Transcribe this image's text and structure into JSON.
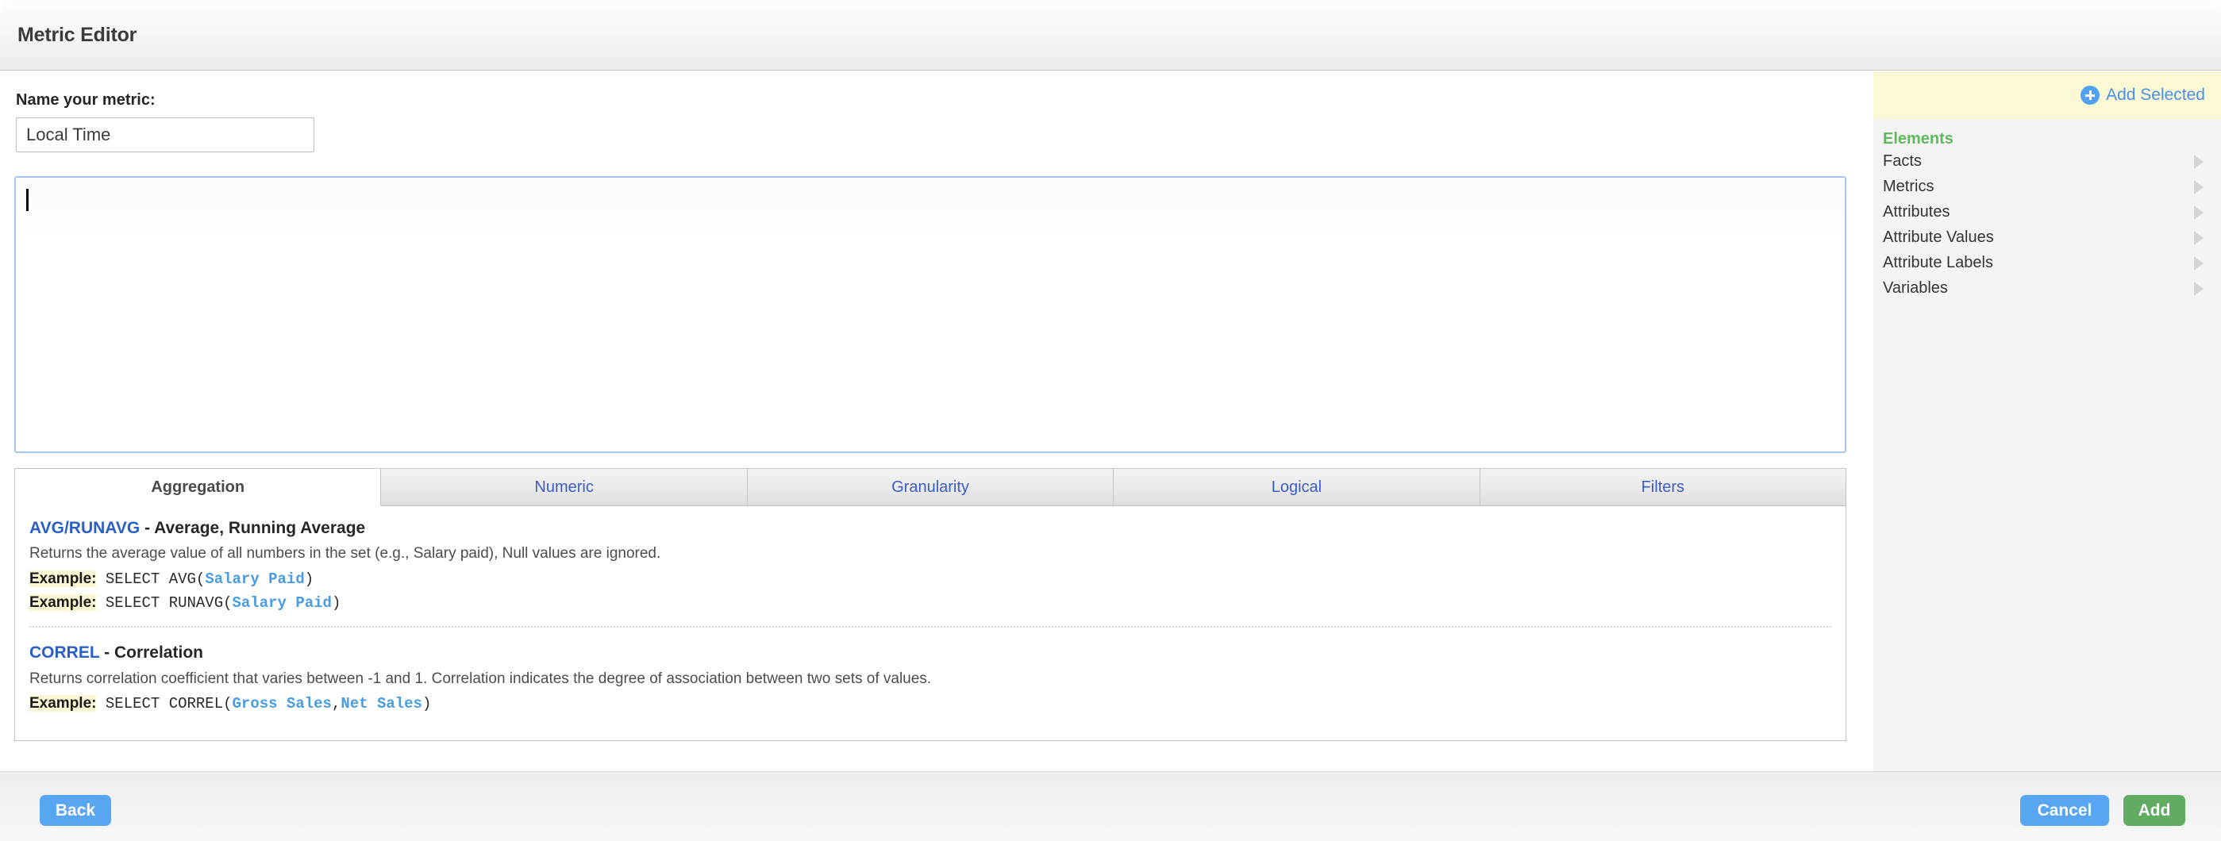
{
  "window": {
    "title": "Metric Editor"
  },
  "form": {
    "name_label": "Name your metric:",
    "name_value": "Local Time",
    "name_placeholder": "",
    "formula_value": "",
    "formula_placeholder": ""
  },
  "tabs": [
    {
      "label": "Aggregation",
      "active": true
    },
    {
      "label": "Numeric",
      "active": false
    },
    {
      "label": "Granularity",
      "active": false
    },
    {
      "label": "Logical",
      "active": false
    },
    {
      "label": "Filters",
      "active": false
    }
  ],
  "functions": [
    {
      "names": [
        "AVG",
        "RUNAVG"
      ],
      "separator": "/",
      "title_suffix": " - Average, Running Average",
      "description": "Returns the average value of all numbers in the set (e.g., Salary paid), Null values are ignored.",
      "examples": [
        {
          "label": "Example:",
          "prefix": " SELECT AVG(",
          "args": [
            "Salary Paid"
          ],
          "suffix": ")"
        },
        {
          "label": "Example:",
          "prefix": " SELECT RUNAVG(",
          "args": [
            "Salary Paid"
          ],
          "suffix": ")"
        }
      ]
    },
    {
      "names": [
        "CORREL"
      ],
      "separator": "",
      "title_suffix": " - Correlation",
      "description": "Returns correlation coefficient that varies between -1 and 1. Correlation indicates the degree of association between two sets of values.",
      "examples": [
        {
          "label": "Example:",
          "prefix": " SELECT CORREL(",
          "args": [
            "Gross Sales",
            "Net Sales"
          ],
          "arg_separator": ",",
          "suffix": ")"
        }
      ]
    }
  ],
  "sidebar": {
    "add_selected_label": "Add Selected",
    "add_icon": "plus-circle-icon",
    "section_title": "Elements",
    "items": [
      {
        "label": "Facts",
        "icon": "chevron-right-icon"
      },
      {
        "label": "Metrics",
        "icon": "chevron-right-icon"
      },
      {
        "label": "Attributes",
        "icon": "chevron-right-icon"
      },
      {
        "label": "Attribute Values",
        "icon": "chevron-right-icon"
      },
      {
        "label": "Attribute Labels",
        "icon": "chevron-right-icon"
      },
      {
        "label": "Variables",
        "icon": "chevron-right-icon"
      }
    ]
  },
  "footer": {
    "back_label": "Back",
    "cancel_label": "Cancel",
    "add_label": "Add"
  },
  "colors": {
    "accent_blue": "#58a6f2",
    "accent_green": "#62ab62",
    "link_blue": "#3b5ec4",
    "elements_green": "#5dba5d",
    "highlight_yellow": "#fbf8d4",
    "code_arg_blue": "#4a9ce0"
  }
}
